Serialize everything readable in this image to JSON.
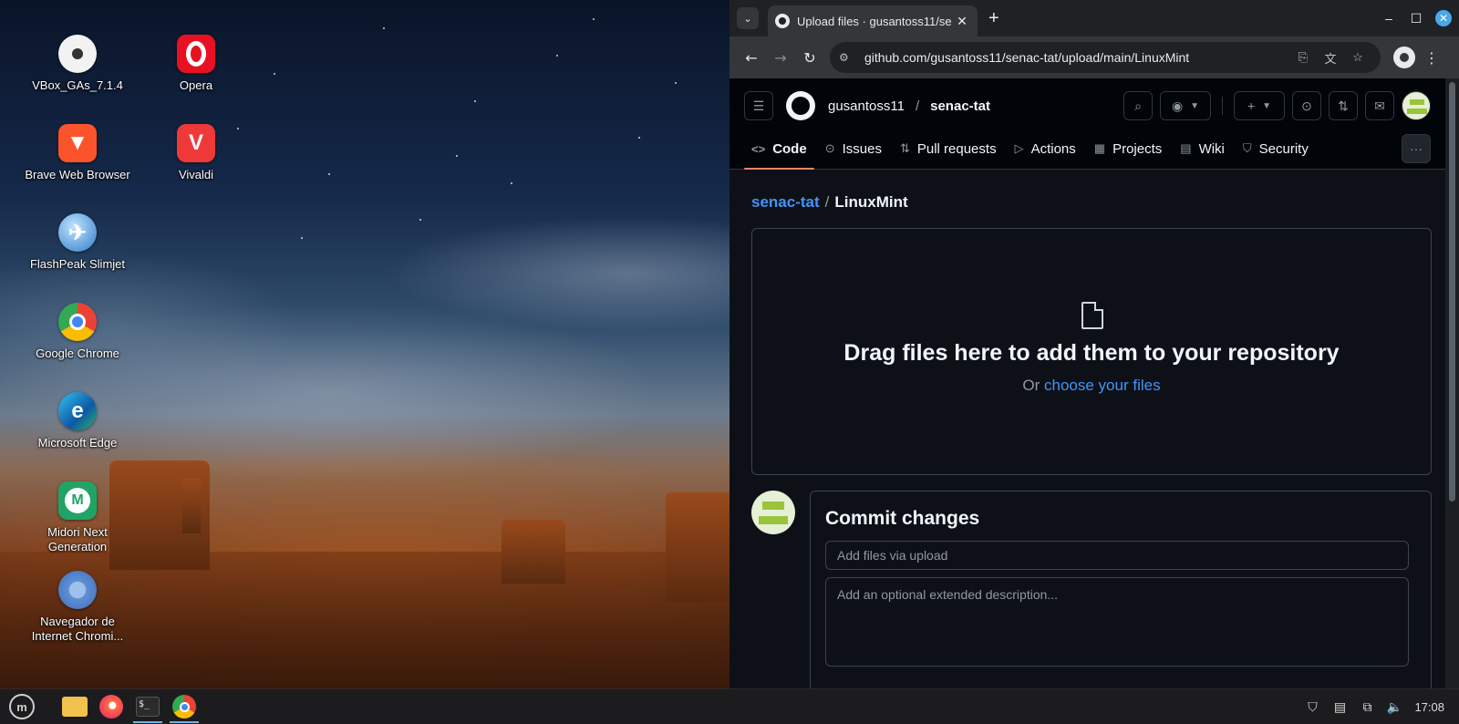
{
  "desktop": {
    "icons": [
      {
        "label": "VBox_GAs_7.1.4",
        "icon": "disc-icon",
        "color": "#f2f2f2"
      },
      {
        "label": "Opera",
        "icon": "opera-icon",
        "color": "#e81123"
      },
      {
        "label": "Brave Web Browser",
        "icon": "brave-icon",
        "color": "#fb542b"
      },
      {
        "label": "Vivaldi",
        "icon": "vivaldi-icon",
        "color": "#ef3939"
      },
      {
        "label": "FlashPeak Slimjet",
        "icon": "slimjet-icon",
        "color": "#3a8fd8"
      },
      {
        "label": "Google Chrome",
        "icon": "chrome-icon",
        "color": "#4285f4"
      },
      {
        "label": "Microsoft Edge",
        "icon": "edge-icon",
        "color": "#0c8de0"
      },
      {
        "label": "Midori Next Generation",
        "icon": "midori-icon",
        "color": "#21a366"
      },
      {
        "label": "Navegador de Internet Chromi...",
        "icon": "chromium-icon",
        "color": "#5f8fd6"
      }
    ]
  },
  "taskbar": {
    "apps": [
      "mint-menu-icon",
      "files-icon",
      "firefox-icon",
      "terminal-icon",
      "chrome-icon"
    ],
    "clock": "17:08"
  },
  "browser": {
    "tab_title": "Upload files · gusantoss11/se",
    "url": "github.com/gusantoss11/senac-tat/upload/main/LinuxMint"
  },
  "github": {
    "owner": "gusantoss11",
    "repo": "senac-tat",
    "tabs": [
      {
        "label": "Code",
        "icon": "code-icon",
        "selected": true
      },
      {
        "label": "Issues",
        "icon": "issues-icon"
      },
      {
        "label": "Pull requests",
        "icon": "pull-request-icon"
      },
      {
        "label": "Actions",
        "icon": "actions-icon"
      },
      {
        "label": "Projects",
        "icon": "projects-icon"
      },
      {
        "label": "Wiki",
        "icon": "wiki-icon"
      },
      {
        "label": "Security",
        "icon": "security-icon"
      }
    ],
    "breadcrumb": {
      "repo": "senac-tat",
      "sep": "/",
      "folder": "LinuxMint"
    },
    "dropzone": {
      "title": "Drag files here to add them to your repository",
      "or": "Or",
      "choose": "choose your files"
    },
    "commit": {
      "title": "Commit changes",
      "summary_placeholder": "Add files via upload",
      "description_placeholder": "Add an optional extended description..."
    }
  },
  "colors": {
    "accent": "#4493f8",
    "tab_underline": "#f78166",
    "page_bg": "#0d1117"
  }
}
